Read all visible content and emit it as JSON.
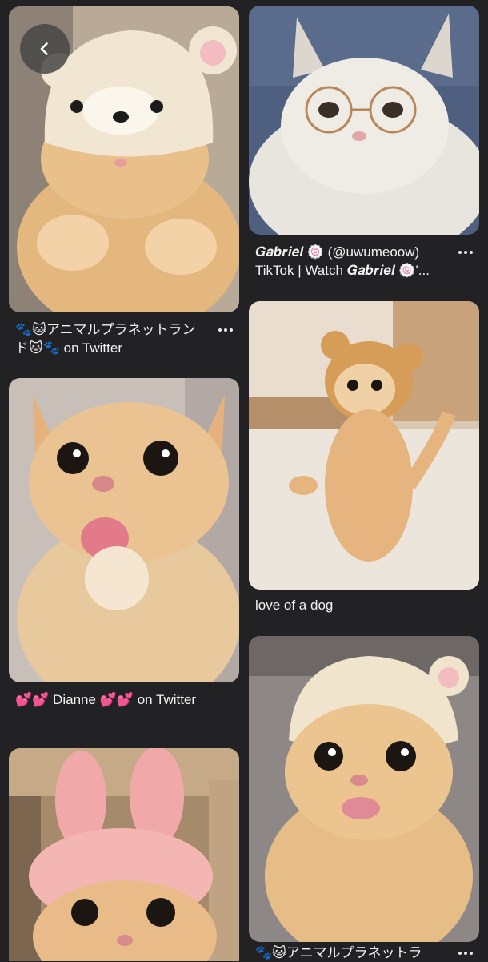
{
  "nav": {
    "back_icon": "chevron-left-icon"
  },
  "pins": [
    {
      "id": "pin-1",
      "column": "left",
      "image": "cat wearing cream bear hat",
      "caption": "🐾🐱アニマルプラネットランド🐱🐾 on Twitter",
      "more_icon": "more-horizontal-icon"
    },
    {
      "id": "pin-2",
      "column": "right",
      "image": "white fluffy cat wearing round glasses",
      "caption": "𝑮𝒂𝒃𝒓𝒊𝒆𝒍 🍥 (@uwumeoow) TikTok | Watch 𝑮𝒂𝒃𝒓𝒊𝒆𝒍 🍥'...",
      "more_icon": "more-horizontal-icon"
    },
    {
      "id": "pin-3",
      "column": "right",
      "image": "orange cat standing up in bear hat",
      "caption": "love of a dog",
      "more_icon": ""
    },
    {
      "id": "pin-4",
      "column": "left",
      "image": "orange cat sticking tongue out",
      "caption": "💕💕 Dianne 💕💕 on Twitter",
      "more_icon": ""
    },
    {
      "id": "pin-5",
      "column": "right",
      "image": "orange cat in cream hat with tongue out",
      "caption": "🐾🐱アニマルプラネットラ",
      "more_icon": "more-horizontal-icon"
    },
    {
      "id": "pin-6",
      "column": "left",
      "image": "orange cat wearing pink bunny ears hat",
      "caption": "",
      "more_icon": ""
    }
  ],
  "colors": {
    "background": "#222224",
    "text": "#f2f2f2"
  }
}
